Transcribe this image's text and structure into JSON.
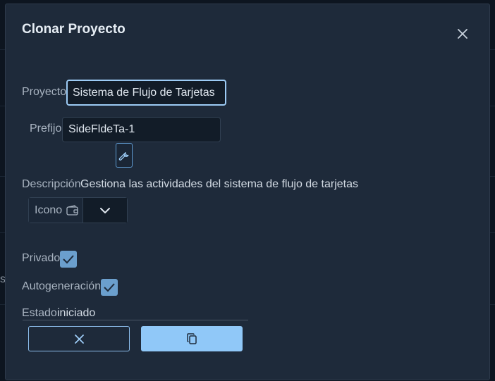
{
  "background": {
    "partial_label": "s"
  },
  "dialog": {
    "title": "Clonar Proyecto",
    "close_icon": "close-icon"
  },
  "form": {
    "project": {
      "label": "Proyecto",
      "value": "Sistema de Flujo de Tarjetas"
    },
    "prefix": {
      "label": "Prefijo",
      "value": "SideFldeTa-1",
      "tool_icon": "wrench-icon"
    },
    "description": {
      "label": "Descripción",
      "value": "Gestiona las actividades del sistema de flujo de tarjetas"
    },
    "icon": {
      "label": "Icono",
      "preview_icon": "wallet-icon",
      "select_icon": "chevron-down-icon"
    },
    "private": {
      "label": "Privado",
      "checked": true
    },
    "autogeneration": {
      "label": "Autogeneración",
      "checked": true
    },
    "status": {
      "label": "Estado",
      "value": "iniciado"
    }
  },
  "actions": {
    "cancel_icon": "close-icon",
    "clone_icon": "copy-icon"
  },
  "colors": {
    "dialog_bg": "#1e2a3a",
    "accent": "#90c8f8",
    "checkbox": "#6b9fcd",
    "focus_border": "#9ccbf5"
  }
}
